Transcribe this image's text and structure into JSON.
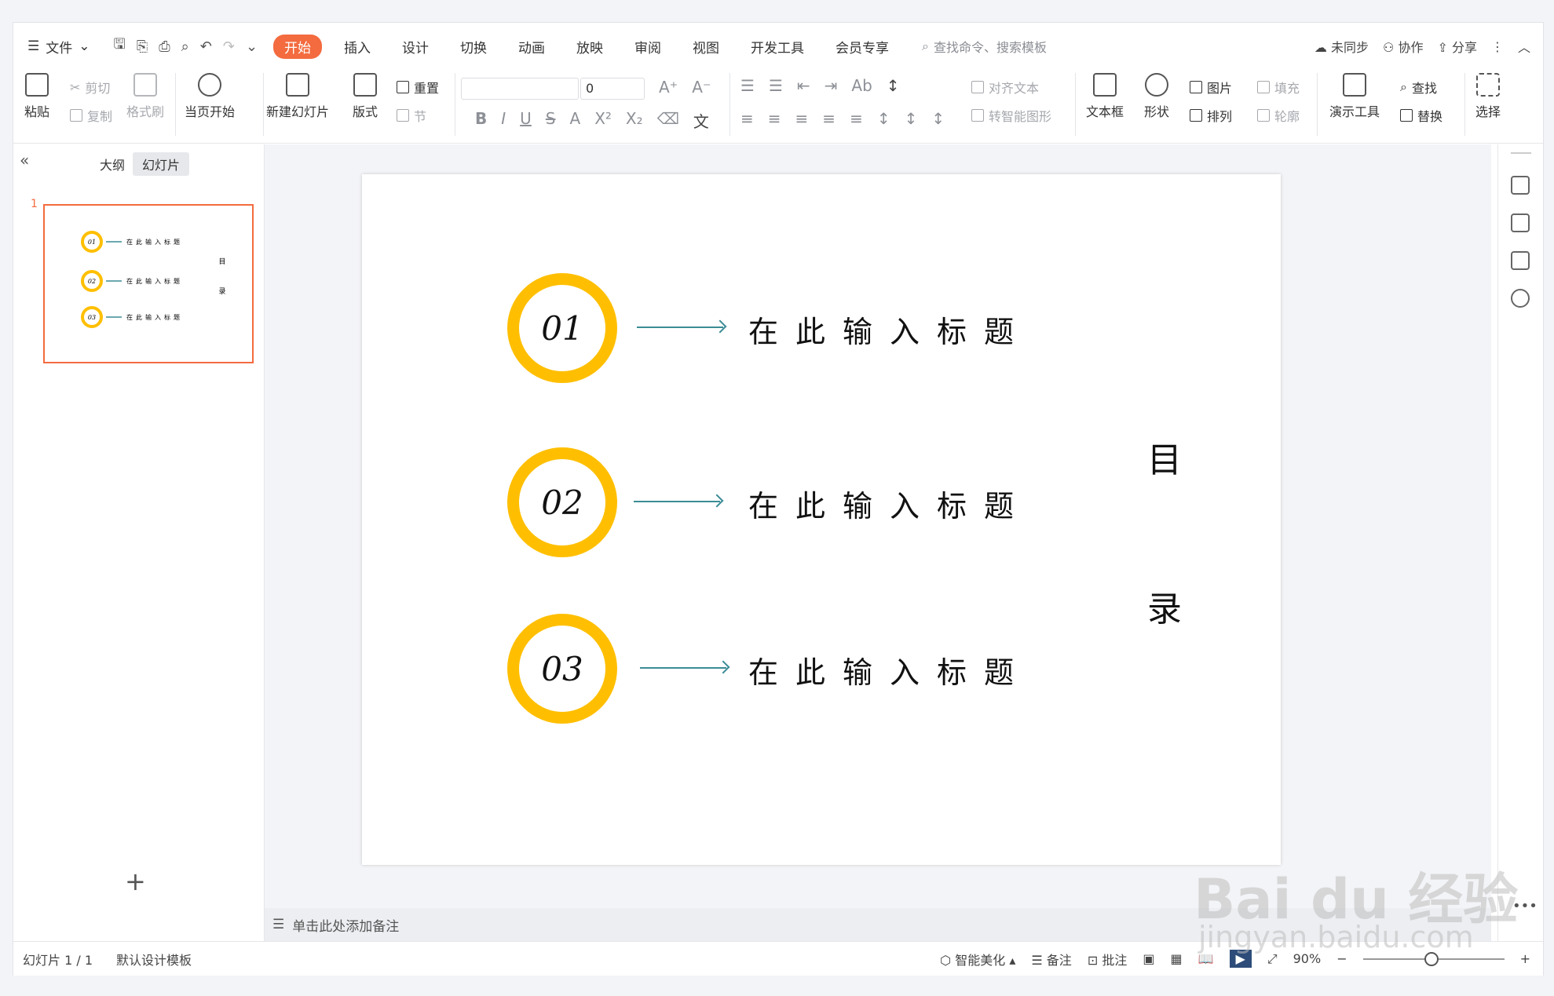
{
  "menu": {
    "file_label": "文件",
    "tabs": [
      "开始",
      "插入",
      "设计",
      "切换",
      "动画",
      "放映",
      "审阅",
      "视图",
      "开发工具",
      "会员专享"
    ],
    "active_tab": "开始",
    "search_placeholder": "查找命令、搜索模板",
    "right": {
      "sync": "未同步",
      "collab": "协作",
      "share": "分享"
    }
  },
  "ribbon": {
    "paste": "粘贴",
    "cut": "剪切",
    "copy": "复制",
    "format_painter": "格式刷",
    "play_from_current": "当页开始",
    "new_slide": "新建幻灯片",
    "layout": "版式",
    "reset": "重置",
    "section": "节",
    "font_size": "0",
    "align_text": "对齐文本",
    "smart_shape": "转智能图形",
    "textbox": "文本框",
    "shape": "形状",
    "picture": "图片",
    "arrange": "排列",
    "fill": "填充",
    "outline": "轮廓",
    "presenter_tools": "演示工具",
    "find": "查找",
    "replace": "替换",
    "select": "选择"
  },
  "left_panel": {
    "tab_outline": "大纲",
    "tab_slides": "幻灯片",
    "thumb_number": "1"
  },
  "slide": {
    "items": [
      {
        "num": "01",
        "title": "在此输入标题"
      },
      {
        "num": "02",
        "title": "在此输入标题"
      },
      {
        "num": "03",
        "title": "在此输入标题"
      }
    ],
    "vertical_title": [
      "目",
      "录"
    ],
    "ring_color": "#ffbf00",
    "arrow_color": "#3b8c95"
  },
  "notes_placeholder": "单击此处添加备注",
  "status": {
    "slide_count": "幻灯片 1 / 1",
    "template": "默认设计模板",
    "smart_beautify": "智能美化",
    "notes": "备注",
    "comments": "批注",
    "zoom": "90%"
  },
  "watermark": {
    "brand": "Bai du 经验",
    "url": "jingyan.baidu.com"
  }
}
